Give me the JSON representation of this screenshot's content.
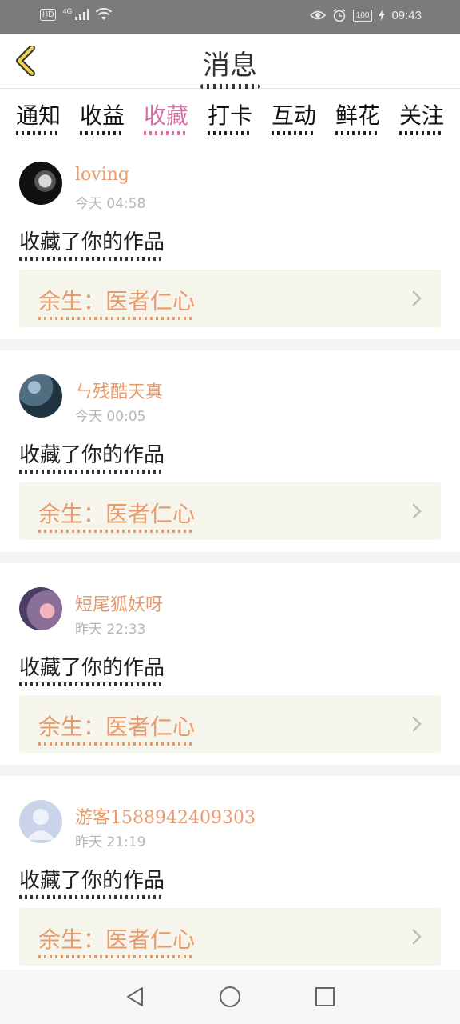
{
  "status_bar": {
    "hd": "HD",
    "network": "4G",
    "battery": "100",
    "time": "09:43",
    "icons": [
      "signal-icon",
      "wifi-icon",
      "eye-icon",
      "alarm-icon",
      "battery-icon",
      "charging-icon"
    ]
  },
  "header": {
    "title": "消息",
    "back_icon": "chevron-left-icon",
    "accent_color": "#f2d34a"
  },
  "tabs": [
    {
      "label": "通知",
      "active": false
    },
    {
      "label": "收益",
      "active": false
    },
    {
      "label": "收藏",
      "active": true
    },
    {
      "label": "打卡",
      "active": false
    },
    {
      "label": "互动",
      "active": false
    },
    {
      "label": "鲜花",
      "active": false
    },
    {
      "label": "关注",
      "active": false
    }
  ],
  "colors": {
    "active_tab": "#d56ea3",
    "username": "#e99a6c",
    "work_box_bg": "#f5f5ec"
  },
  "messages": [
    {
      "username": "loving",
      "time": "今天 04:58",
      "text": "收藏了你的作品",
      "work": "余生：医者仁心"
    },
    {
      "username": "ㄣ残酷天真",
      "time": "今天 00:05",
      "text": "收藏了你的作品",
      "work": "余生：医者仁心"
    },
    {
      "username": "短尾狐妖呀",
      "time": "昨天 22:33",
      "text": "收藏了你的作品",
      "work": "余生：医者仁心"
    },
    {
      "username": "游客1588942409303",
      "time": "昨天 21:19",
      "text": "收藏了你的作品",
      "work": "余生：医者仁心"
    }
  ],
  "system_nav": [
    "back-triangle-icon",
    "home-circle-icon",
    "recents-square-icon"
  ]
}
